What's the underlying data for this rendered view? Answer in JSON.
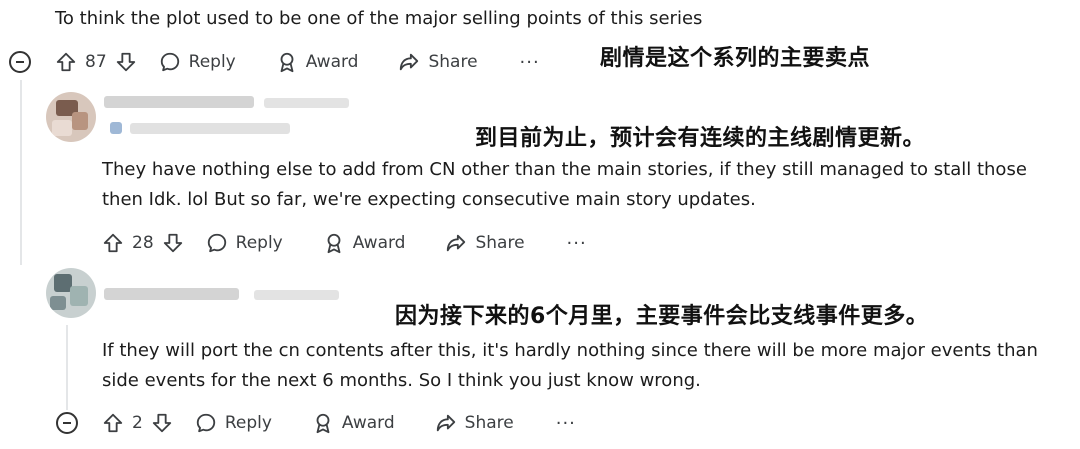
{
  "colors": {
    "text": "#1c1c1c",
    "muted": "#3c3f42",
    "thread_line": "#e4e6e8"
  },
  "comments": [
    {
      "text_lines": [
        "To think the plot used to be one of the major selling points of this series"
      ],
      "votes": "87",
      "translation": "剧情是这个系列的主要卖点"
    },
    {
      "text_lines": [
        "They have nothing else to add from CN other than the main stories, if they still managed to stall those",
        "then Idk. lol But so far, we're expecting consecutive main story updates."
      ],
      "votes": "28",
      "translation": "到目前为止，预计会有连续的主线剧情更新。"
    },
    {
      "text_lines": [
        "If they will port the cn contents after this, it's hardly nothing since there will be more major events than",
        "side events for the next 6 months. So I think you just know wrong."
      ],
      "votes": "2",
      "translation": "因为接下来的6个月里，主要事件会比支线事件更多。"
    }
  ],
  "actions": {
    "reply": "Reply",
    "award": "Award",
    "share": "Share",
    "more": "···"
  },
  "icons": [
    "upvote-icon",
    "downvote-icon",
    "reply-icon",
    "award-icon",
    "share-icon",
    "collapse-icon"
  ]
}
